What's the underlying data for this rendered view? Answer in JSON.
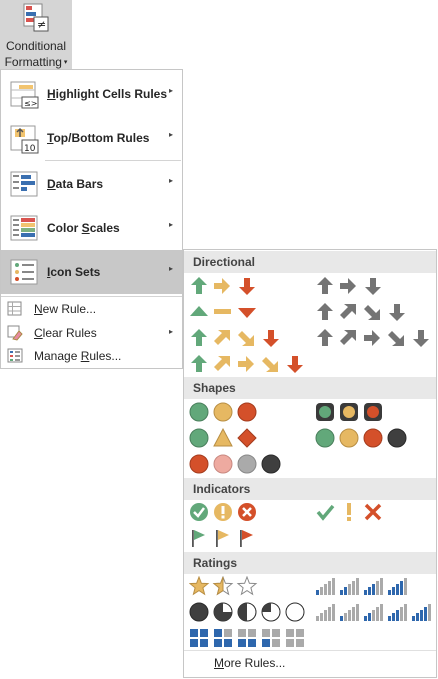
{
  "ribbon_button": {
    "line1": "Conditional",
    "line2": "Formatting",
    "caret": "▾"
  },
  "menu": {
    "highlight": {
      "pre": "",
      "key": "H",
      "post": "ighlight Cells Rules"
    },
    "topbottom": {
      "pre": "",
      "key": "T",
      "post": "op/Bottom Rules"
    },
    "databars": {
      "pre": "",
      "key": "D",
      "post": "ata Bars"
    },
    "colorscales": {
      "pre": "Color ",
      "key": "S",
      "post": "cales"
    },
    "iconsets": {
      "pre": "",
      "key": "I",
      "post": "con Sets"
    },
    "new_rule": {
      "pre": "",
      "key": "N",
      "post": "ew Rule..."
    },
    "clear_rules": {
      "pre": "",
      "key": "C",
      "post": "lear Rules"
    },
    "manage_rules": {
      "pre": "Manage ",
      "key": "R",
      "post": "ules..."
    },
    "arrow": "▸",
    "top10_label": "10",
    "lt_label": "≤>"
  },
  "gallery": {
    "directional": "Directional",
    "shapes": "Shapes",
    "indicators": "Indicators",
    "ratings": "Ratings",
    "more_rules": {
      "pre": "",
      "key": "M",
      "post": "ore Rules..."
    }
  },
  "colors": {
    "green": "#62a87a",
    "yellow": "#e6b862",
    "red": "#d4502a",
    "gray": "#747474",
    "blue": "#2e67ad"
  }
}
